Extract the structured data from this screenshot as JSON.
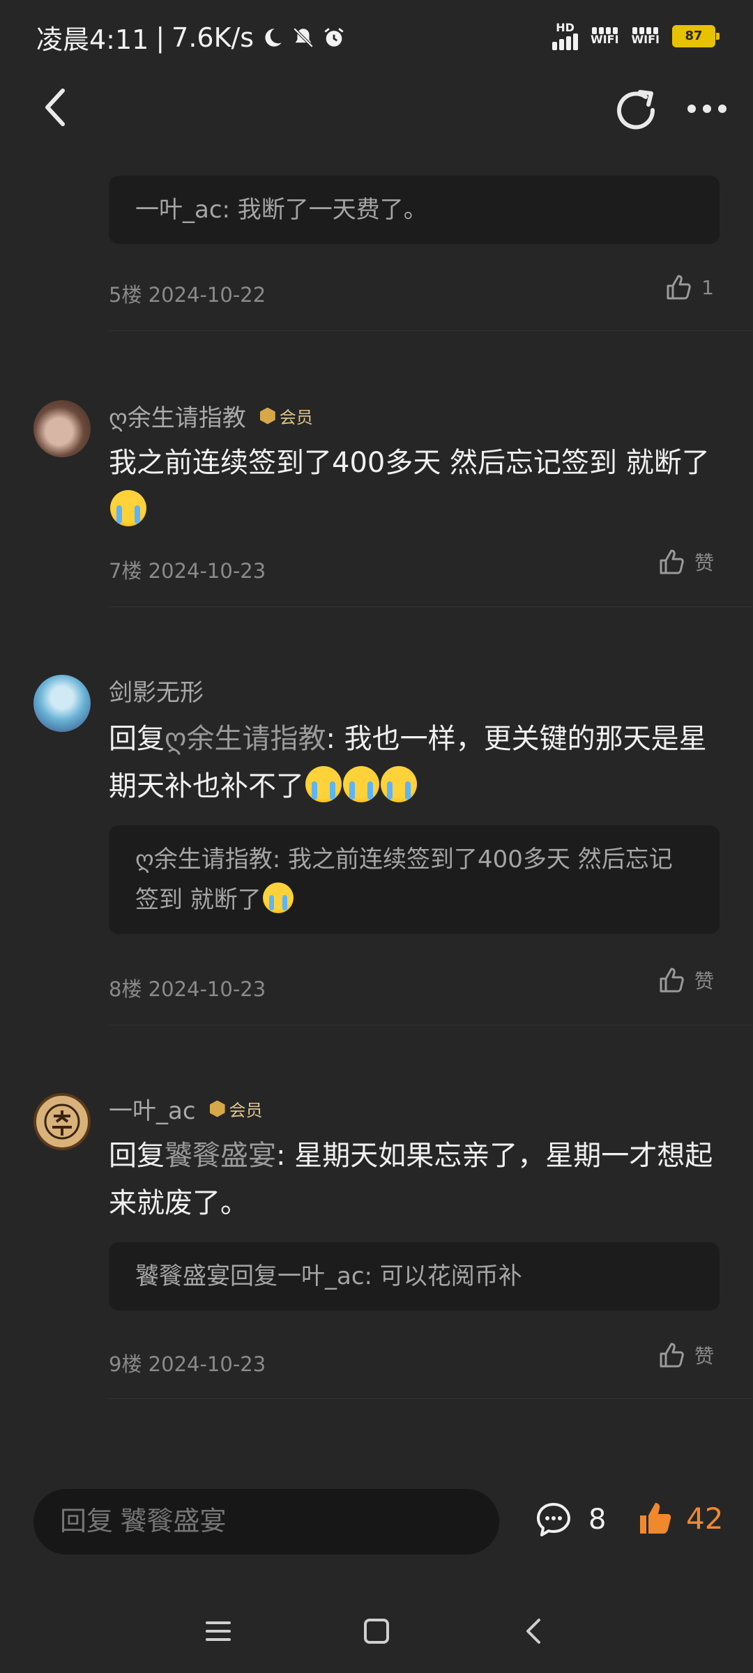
{
  "status_bar": {
    "time": "凌晨4:11",
    "speed": "7.6K/s",
    "hd": "HD",
    "wifi1": "WIFI",
    "wifi2": "WIFI",
    "battery": "87"
  },
  "header": {
    "back_icon": "chevron-left-icon",
    "refresh_icon": "refresh-icon",
    "more_icon": "more-horizontal-icon"
  },
  "comments": [
    {
      "quote": "一叶_ac: 我断了一天费了。",
      "floor": "5楼 2024-10-22",
      "likes": "1"
    },
    {
      "user": "ღ余生请指教",
      "vip": "会员",
      "text": "我之前连续签到了400多天 然后忘记签到 就断了",
      "floor": "7楼 2024-10-23",
      "likes": "赞"
    },
    {
      "user": "剑影无形",
      "reply_prefix": "回复",
      "reply_to": "ღ余生请指教",
      "text": ": 我也一样，更关键的那天是星期天补也补不了",
      "quote": "ღ余生请指教: 我之前连续签到了400多天 然后忘记签到 就断了",
      "floor": "8楼 2024-10-23",
      "likes": "赞"
    },
    {
      "user": "一叶_ac",
      "vip": "会员",
      "reply_prefix": "回复",
      "reply_to": "饕餮盛宴",
      "text": ": 星期天如果忘亲了，星期一才想起来就废了。",
      "quote": "饕餮盛宴回复一叶_ac: 可以花阅币补",
      "floor": "9楼 2024-10-23",
      "likes": "赞"
    }
  ],
  "bottom": {
    "reply_placeholder": "回复 饕餮盛宴",
    "comment_count": "8",
    "like_count": "42",
    "accent": "#f0892e"
  }
}
